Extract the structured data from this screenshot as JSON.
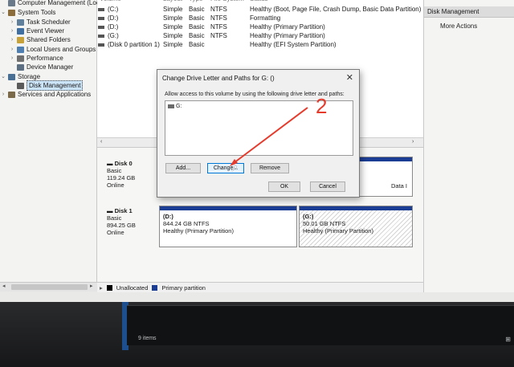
{
  "tree": {
    "items": [
      {
        "label": "Computer Management (Local",
        "indent": 0,
        "chev": "",
        "color": "#6b7a8a"
      },
      {
        "label": "System Tools",
        "indent": 0,
        "chev": "⌄",
        "color": "#8a6d3b"
      },
      {
        "label": "Task Scheduler",
        "indent": 1,
        "chev": "›",
        "color": "#5f7f9a"
      },
      {
        "label": "Event Viewer",
        "indent": 1,
        "chev": "›",
        "color": "#3f6fa0"
      },
      {
        "label": "Shared Folders",
        "indent": 1,
        "chev": "›",
        "color": "#c7a23a"
      },
      {
        "label": "Local Users and Groups",
        "indent": 1,
        "chev": "›",
        "color": "#4f7fb0"
      },
      {
        "label": "Performance",
        "indent": 1,
        "chev": "›",
        "color": "#6f6f6f"
      },
      {
        "label": "Device Manager",
        "indent": 1,
        "chev": "",
        "color": "#5b6e82"
      },
      {
        "label": "Storage",
        "indent": 0,
        "chev": "⌄",
        "color": "#4a6f95"
      },
      {
        "label": "Disk Management",
        "indent": 1,
        "chev": "",
        "color": "#5a5a5a",
        "selected": true
      },
      {
        "label": "Services and Applications",
        "indent": 0,
        "chev": "›",
        "color": "#7a6a4a"
      }
    ]
  },
  "volumes": {
    "headers": [
      "Volume",
      "Layout",
      "Type",
      "File System",
      "Status"
    ],
    "rows": [
      {
        "volume": "(C:)",
        "layout": "Simple",
        "type": "Basic",
        "fs": "NTFS",
        "status": "Healthy (Boot, Page File, Crash Dump, Basic Data Partition)"
      },
      {
        "volume": "(D:)",
        "layout": "Simple",
        "type": "Basic",
        "fs": "NTFS",
        "status": "Formatting"
      },
      {
        "volume": "(D:)",
        "layout": "Simple",
        "type": "Basic",
        "fs": "NTFS",
        "status": "Healthy (Primary Partition)"
      },
      {
        "volume": "(G:)",
        "layout": "Simple",
        "type": "Basic",
        "fs": "NTFS",
        "status": "Healthy (Primary Partition)"
      },
      {
        "volume": "(Disk 0 partition 1)",
        "layout": "Simple",
        "type": "Basic",
        "fs": "",
        "status": "Healthy (EFI System Partition)"
      }
    ]
  },
  "disks": [
    {
      "name": "Disk 0",
      "type": "Basic",
      "size": "119.24 GB",
      "state": "Online"
    },
    {
      "name": "Disk 1",
      "type": "Basic",
      "size": "894.25 GB",
      "state": "Online"
    }
  ],
  "disk0_partial_label": "Data I",
  "partitions": {
    "d": {
      "name": "(D:)",
      "size": "844.24 GB NTFS",
      "status": "Healthy (Primary Partition)"
    },
    "g": {
      "name": "(G:)",
      "size": "50.01 GB NTFS",
      "status": "Healthy (Primary Partition)"
    }
  },
  "legend": {
    "unallocated": "Unallocated",
    "primary": "Primary partition",
    "unallocated_color": "#000000",
    "primary_color": "#1b3d94"
  },
  "actions": {
    "header": "Disk Management",
    "more": "More Actions"
  },
  "dialog": {
    "title": "Change Drive Letter and Paths for G: ()",
    "instruction": "Allow access to this volume by using the following drive letter and paths:",
    "entry": "G:",
    "add": "Add...",
    "change": "Change...",
    "remove": "Remove",
    "ok": "OK",
    "cancel": "Cancel"
  },
  "annotation": {
    "text": "2",
    "color": "#e53b2c"
  },
  "status_bar": {
    "items": "9 items"
  },
  "corner": "⊞"
}
